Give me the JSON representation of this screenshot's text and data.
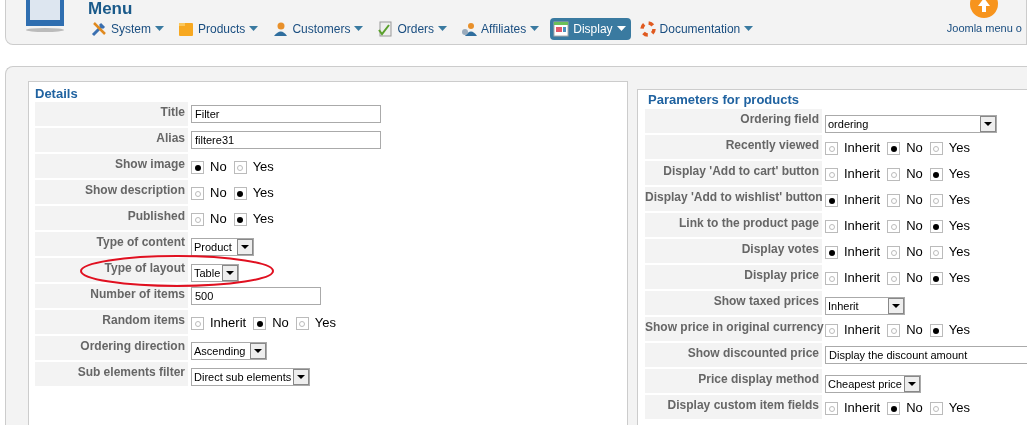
{
  "header": {
    "title": "Menu",
    "menu": [
      {
        "label": "System",
        "selected": false
      },
      {
        "label": "Products",
        "selected": false
      },
      {
        "label": "Customers",
        "selected": false
      },
      {
        "label": "Orders",
        "selected": false
      },
      {
        "label": "Affiliates",
        "selected": false
      },
      {
        "label": "Display",
        "selected": true
      },
      {
        "label": "Documentation",
        "selected": false
      }
    ],
    "update_label": "Joomla menu o"
  },
  "details": {
    "title": "Details",
    "rows": [
      {
        "label": "Title",
        "kind": "text",
        "value": "Filter"
      },
      {
        "label": "Alias",
        "kind": "text",
        "value": "filtere31"
      },
      {
        "label": "Show image",
        "kind": "radio",
        "options": [
          {
            "label": "No",
            "selected": true
          },
          {
            "label": "Yes",
            "selected": false
          }
        ]
      },
      {
        "label": "Show description",
        "kind": "radio",
        "options": [
          {
            "label": "No",
            "selected": false
          },
          {
            "label": "Yes",
            "selected": true
          }
        ]
      },
      {
        "label": "Published",
        "kind": "radio",
        "options": [
          {
            "label": "No",
            "selected": false
          },
          {
            "label": "Yes",
            "selected": true
          }
        ]
      },
      {
        "label": "Type of content",
        "kind": "select",
        "value": "Product"
      },
      {
        "label": "Type of layout",
        "kind": "select",
        "value": "Table",
        "circled": true
      },
      {
        "label": "Number of items",
        "kind": "text",
        "value": "500"
      },
      {
        "label": "Random items",
        "kind": "radio",
        "options": [
          {
            "label": "Inherit",
            "selected": false
          },
          {
            "label": "No",
            "selected": true
          },
          {
            "label": "Yes",
            "selected": false
          }
        ]
      },
      {
        "label": "Ordering direction",
        "kind": "select",
        "value": "Ascending"
      },
      {
        "label": "Sub elements filter",
        "kind": "select",
        "value": "Direct sub elements"
      }
    ]
  },
  "parameters": {
    "title": "Parameters for products",
    "rows": [
      {
        "label": "Ordering field",
        "kind": "select",
        "value": "ordering"
      },
      {
        "label": "Recently viewed",
        "kind": "radio",
        "options": [
          {
            "label": "Inherit",
            "selected": false
          },
          {
            "label": "No",
            "selected": true
          },
          {
            "label": "Yes",
            "selected": false
          }
        ]
      },
      {
        "label": "Display 'Add to cart' button",
        "kind": "radio",
        "options": [
          {
            "label": "Inherit",
            "selected": false
          },
          {
            "label": "No",
            "selected": false
          },
          {
            "label": "Yes",
            "selected": true
          }
        ]
      },
      {
        "label": "Display 'Add to wishlist' button",
        "kind": "radio",
        "options": [
          {
            "label": "Inherit",
            "selected": true
          },
          {
            "label": "No",
            "selected": false
          },
          {
            "label": "Yes",
            "selected": false
          }
        ]
      },
      {
        "label": "Link to the product page",
        "kind": "radio",
        "options": [
          {
            "label": "Inherit",
            "selected": false
          },
          {
            "label": "No",
            "selected": false
          },
          {
            "label": "Yes",
            "selected": true
          }
        ]
      },
      {
        "label": "Display votes",
        "kind": "radio",
        "options": [
          {
            "label": "Inherit",
            "selected": true
          },
          {
            "label": "No",
            "selected": false
          },
          {
            "label": "Yes",
            "selected": false
          }
        ]
      },
      {
        "label": "Display price",
        "kind": "radio",
        "options": [
          {
            "label": "Inherit",
            "selected": false
          },
          {
            "label": "No",
            "selected": false
          },
          {
            "label": "Yes",
            "selected": true
          }
        ]
      },
      {
        "label": "Show taxed prices",
        "kind": "select",
        "value": "Inherit"
      },
      {
        "label": "Show price in original currency",
        "kind": "radio",
        "options": [
          {
            "label": "Inherit",
            "selected": false
          },
          {
            "label": "No",
            "selected": false
          },
          {
            "label": "Yes",
            "selected": true
          }
        ]
      },
      {
        "label": "Show discounted price",
        "kind": "text",
        "value": "Display the discount amount"
      },
      {
        "label": "Price display method",
        "kind": "select",
        "value": "Cheapest price"
      },
      {
        "label": "Display custom item fields",
        "kind": "radio",
        "options": [
          {
            "label": "Inherit",
            "selected": false
          },
          {
            "label": "No",
            "selected": true
          },
          {
            "label": "Yes",
            "selected": false
          }
        ]
      }
    ]
  }
}
